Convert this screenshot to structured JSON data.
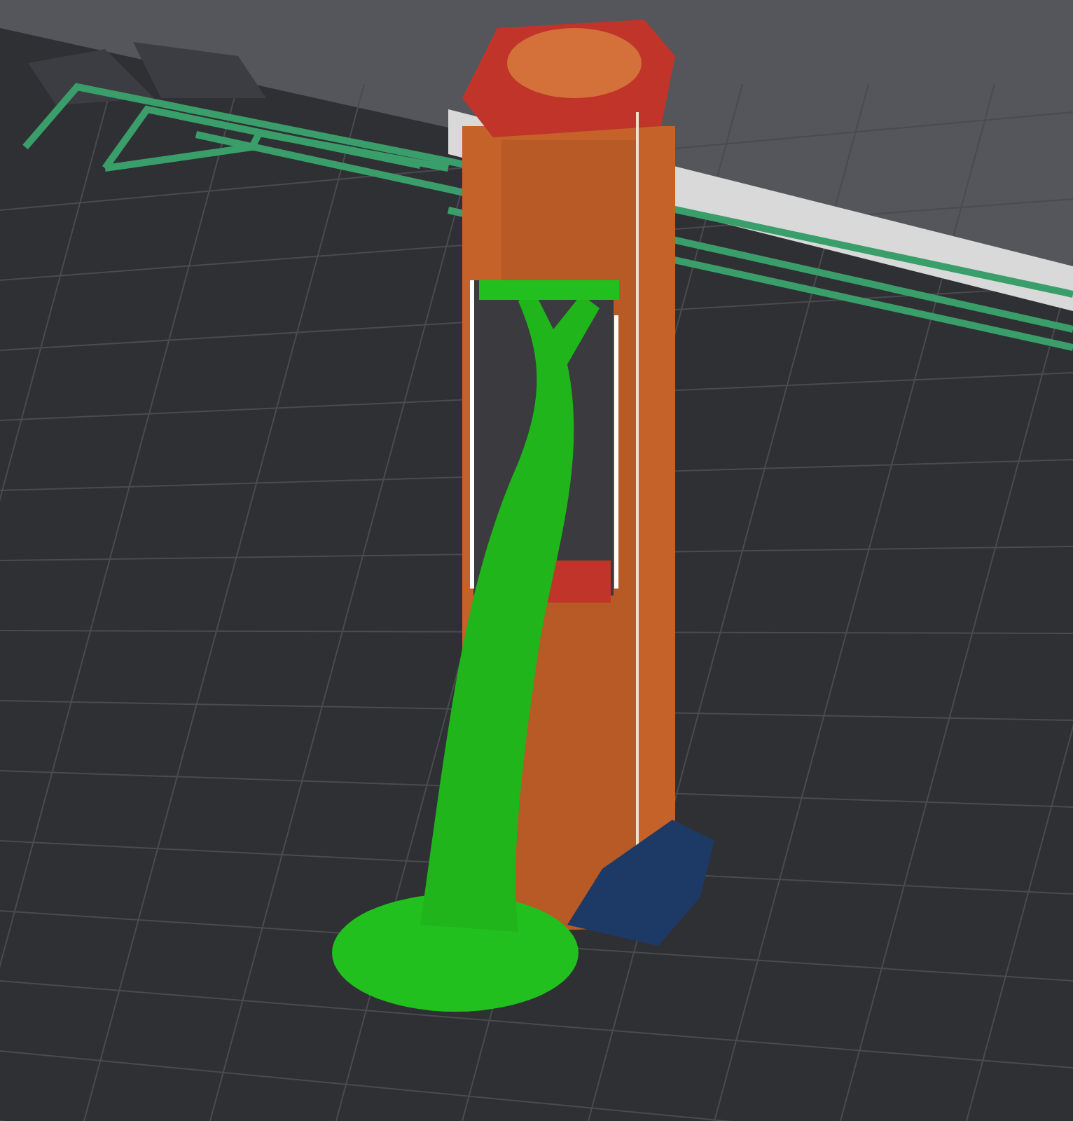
{
  "viewport": {
    "parts": [
      {
        "kind": "bed",
        "color": "#2f3034"
      },
      {
        "kind": "tower",
        "color": "#c4622a"
      },
      {
        "kind": "support",
        "color": "#22c01e"
      },
      {
        "kind": "brim",
        "color": "#1d3a66"
      }
    ]
  }
}
